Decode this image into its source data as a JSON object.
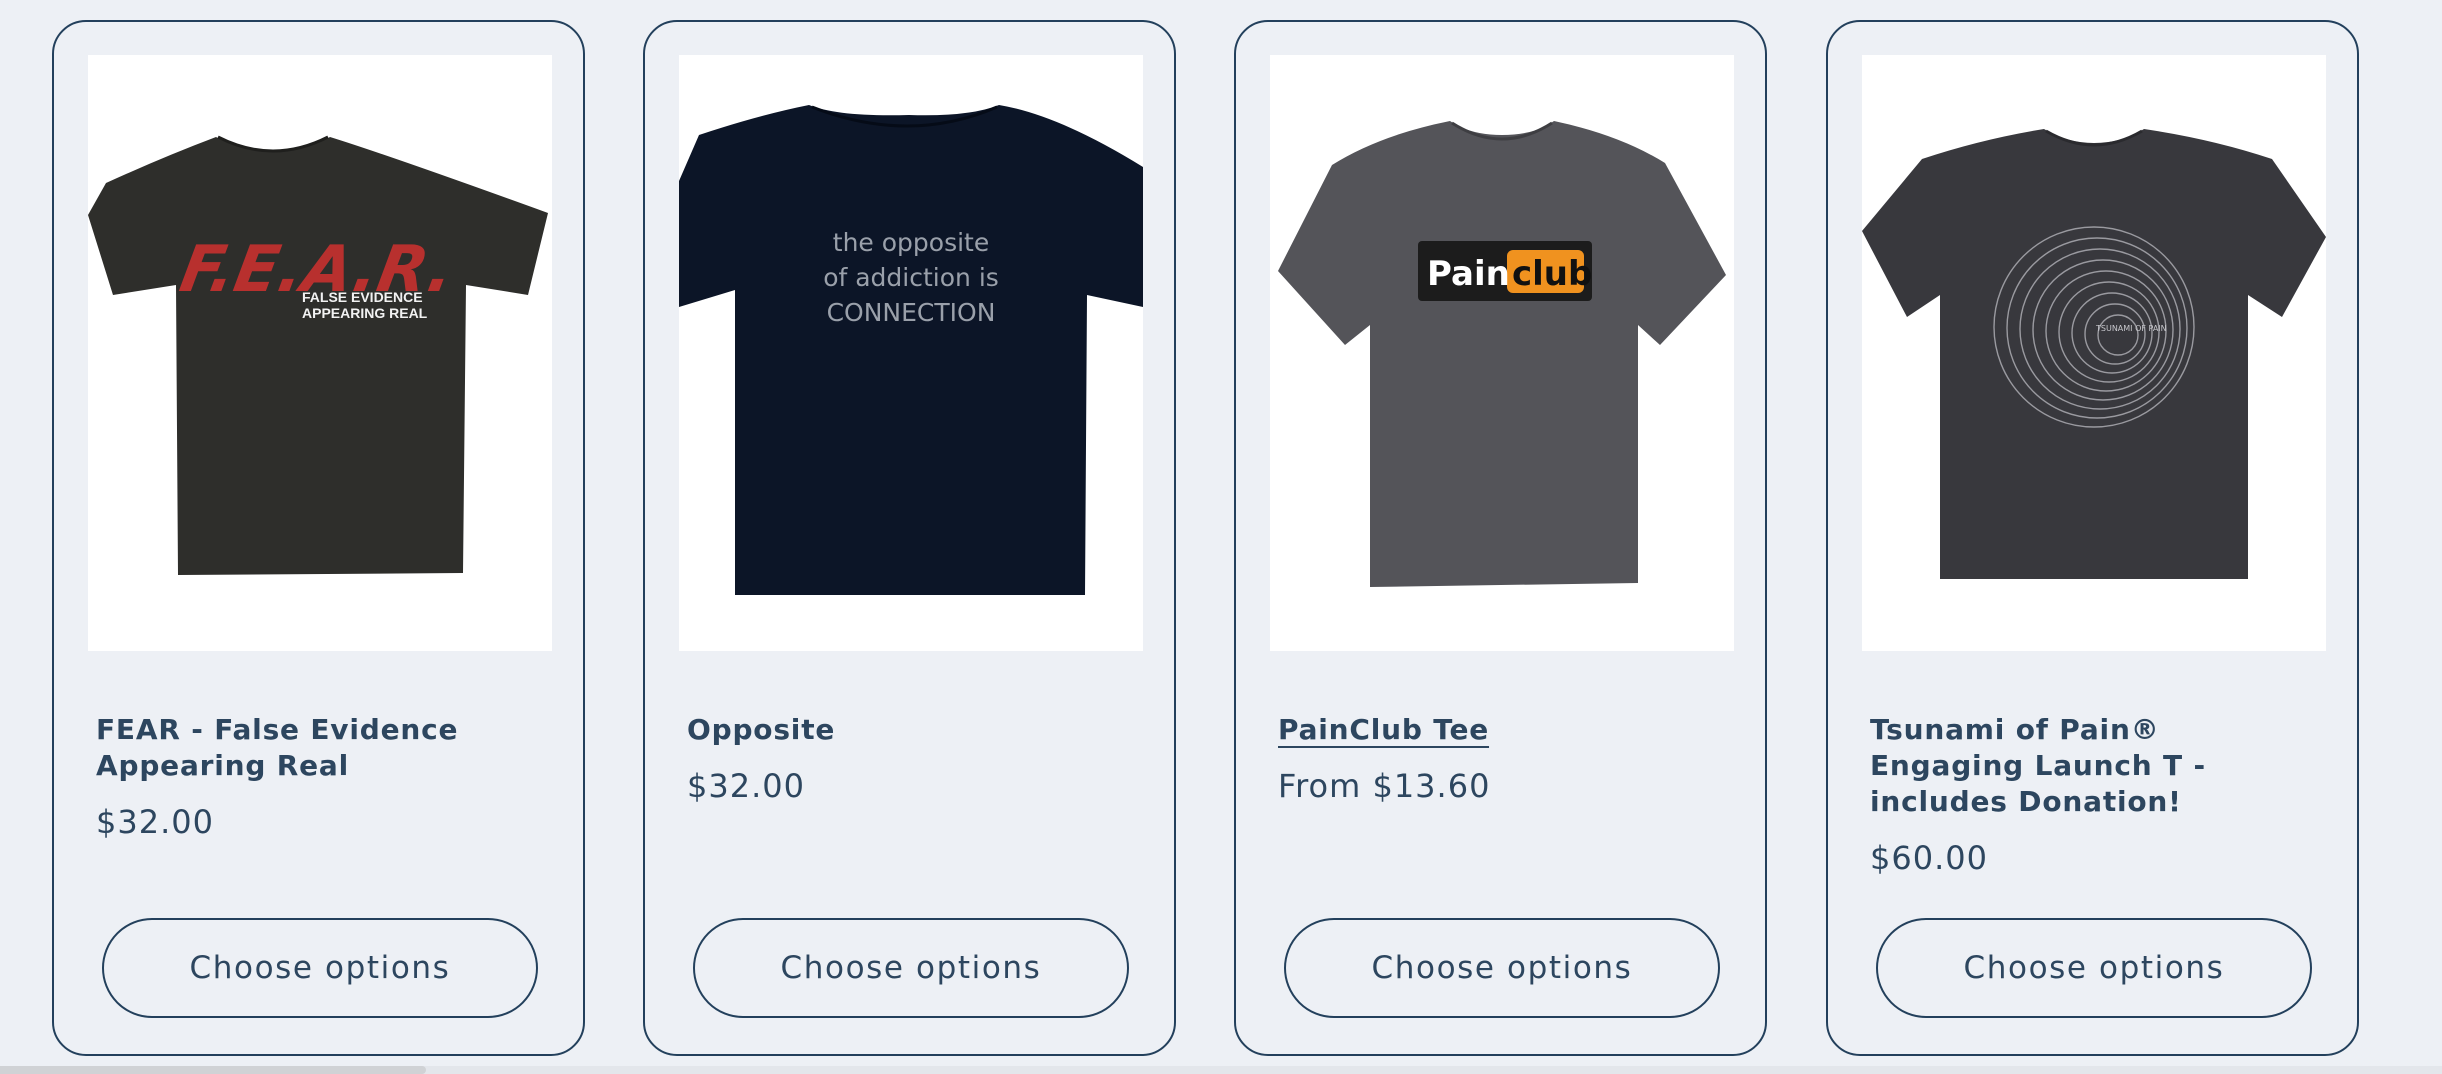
{
  "colors": {
    "page_background": "#edf0f5",
    "card_border": "#23405c",
    "text": "#2d465f"
  },
  "products": [
    {
      "title": "FEAR - False Evidence Appearing Real",
      "price": "$32.00",
      "button_label": "Choose options",
      "shirt_color": "#2e2e2b",
      "print": {
        "main": "F.E.A.R.",
        "line1": "FALSE EVIDENCE",
        "line2": "APPEARING REAL"
      }
    },
    {
      "title": "Opposite",
      "price": "$32.00",
      "button_label": "Choose options",
      "shirt_color": "#0c1527",
      "print": {
        "line1": "the opposite",
        "line2": "of addiction is",
        "line3": "CONNECTION"
      }
    },
    {
      "title": "PainClub Tee",
      "price": "From $13.60",
      "button_label": "Choose options",
      "shirt_color": "#545459",
      "print": {
        "word1": "Pain",
        "word2": "club"
      }
    },
    {
      "title": "Tsunami of Pain® Engaging Launch T - includes Donation!",
      "price": "$60.00",
      "button_label": "Choose options",
      "shirt_color": "#38383d",
      "print": {
        "brand": "TSUNAMI OF PAIN"
      }
    }
  ]
}
